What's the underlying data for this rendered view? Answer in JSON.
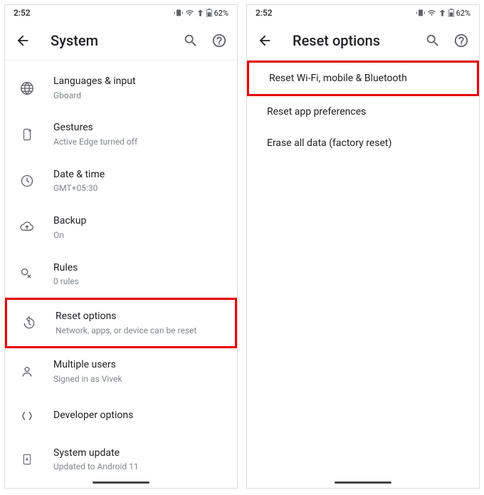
{
  "status": {
    "time": "2:52",
    "battery_text": "62%"
  },
  "left": {
    "title": "System",
    "items": [
      {
        "title": "Languages & input",
        "sub": "Gboard"
      },
      {
        "title": "Gestures",
        "sub": "Active Edge turned off"
      },
      {
        "title": "Date & time",
        "sub": "GMT+05:30"
      },
      {
        "title": "Backup",
        "sub": "On"
      },
      {
        "title": "Rules",
        "sub": "0 rules"
      },
      {
        "title": "Reset options",
        "sub": "Network, apps, or device can be reset"
      },
      {
        "title": "Multiple users",
        "sub": "Signed in as Vivek"
      },
      {
        "title": "Developer options",
        "sub": ""
      },
      {
        "title": "System update",
        "sub": "Updated to Android 11"
      }
    ]
  },
  "right": {
    "title": "Reset options",
    "items": [
      {
        "title": "Reset Wi-Fi, mobile & Bluetooth"
      },
      {
        "title": "Reset app preferences"
      },
      {
        "title": "Erase all data (factory reset)"
      }
    ]
  }
}
